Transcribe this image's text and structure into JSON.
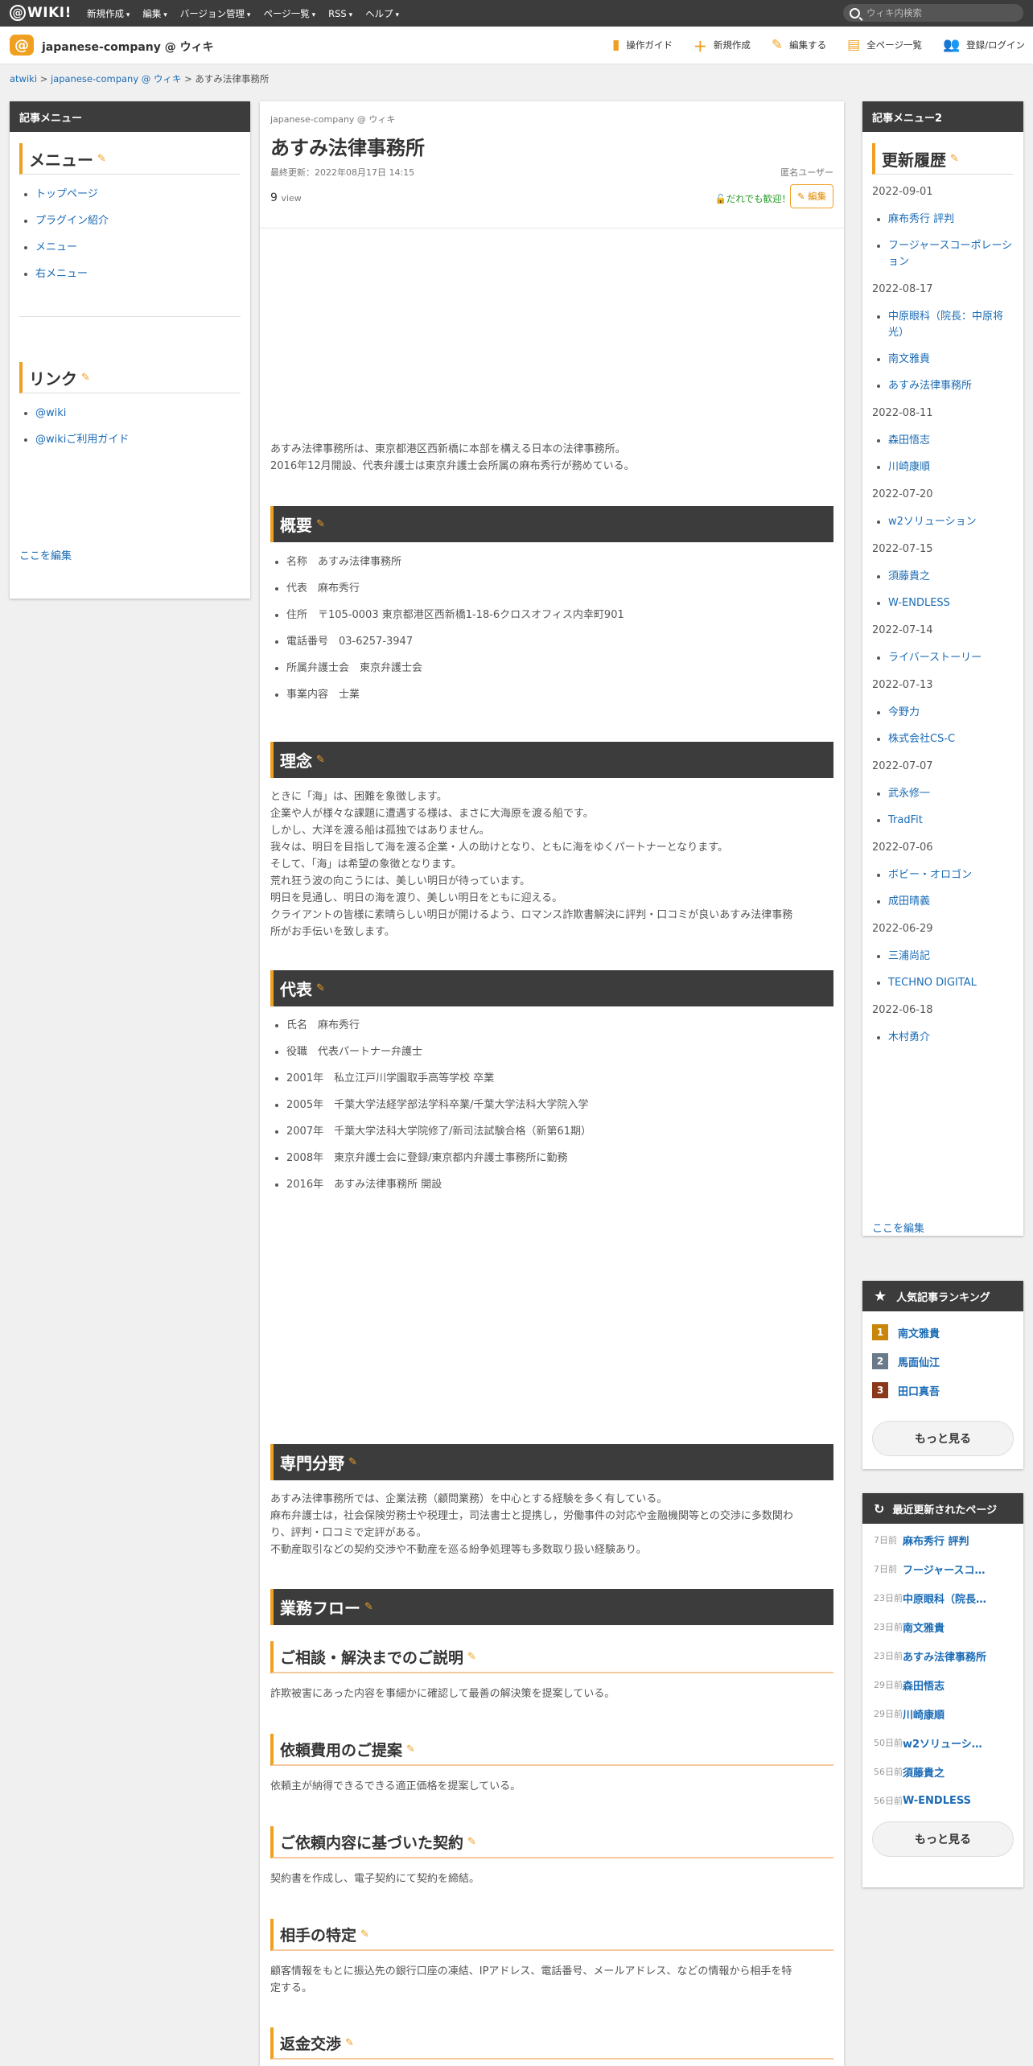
{
  "topbar": {
    "logo_text": "WIKI!",
    "menu": [
      "新規作成",
      "編集",
      "バージョン管理",
      "ページ一覧",
      "RSS",
      "ヘルプ"
    ],
    "search_placeholder": "ウィキ内検索"
  },
  "wikibar": {
    "name": "japanese-company @ ウィキ",
    "tools": [
      "操作ガイド",
      "新規作成",
      "編集する",
      "全ページ一覧",
      "登録/ログイン"
    ]
  },
  "breadcrumb": [
    "atwiki",
    "japanese-company @ ウィキ",
    "あすみ法律事務所"
  ],
  "left": {
    "header": "記事メニュー",
    "menu_title": "メニュー",
    "menu_items": [
      "トップページ",
      "プラグイン紹介",
      "メニュー",
      "右メニュー"
    ],
    "links_title": "リンク",
    "link_items": [
      "@wiki",
      "@wikiご利用ガイド"
    ],
    "edit_here": "ここを編集"
  },
  "article": {
    "wiki_sub": "japanese-company @ ウィキ",
    "title": "あすみ法律事務所",
    "updated": "最終更新：2022年08月17日 14:15",
    "author": "匿名ユーザー",
    "views": "9",
    "views_unit": "view",
    "welcome": "だれでも歓迎！",
    "edit": "編集",
    "intro": [
      "あすみ法律事務所は、東京都港区西新橋に本部を構える日本の法律事務所。",
      "2016年12月開設、代表弁護士は東京弁護士会所属の麻布秀行が務めている。"
    ],
    "overview_title": "概要",
    "overview": [
      "名称　あすみ法律事務所",
      "代表　麻布秀行",
      "住所　〒105-0003 東京都港区西新橋1-18-6クロスオフィス内幸町901",
      "電話番号　03-6257-3947",
      "所属弁護士会　東京弁護士会",
      "事業内容　士業"
    ],
    "philosophy_title": "理念",
    "philosophy": [
      "ときに「海」は、困難を象徴します。",
      "企業や人が様々な課題に遭遇する様は、まさに大海原を渡る船です。",
      "しかし、大洋を渡る船は孤独ではありません。",
      "我々は、明日を目指して海を渡る企業・人の助けとなり、ともに海をゆくパートナーとなります。",
      "そして、「海」は希望の象徴となります。",
      "荒れ狂う波の向こうには、美しい明日が待っています。",
      "明日を見通し、明日の海を渡り、美しい明日をともに迎える。",
      "クライアントの皆様に素晴らしい明日が開けるよう、ロマンス詐欺書解決に評判・口コミが良いあすみ法律事務",
      "所がお手伝いを致します。"
    ],
    "rep_title": "代表",
    "rep": [
      "氏名　麻布秀行",
      "役職　代表パートナー弁護士",
      "2001年　私立江戸川学園取手高等学校 卒業",
      "2005年　千葉大学法経学部法学科卒業/千葉大学法科大学院入学",
      "2007年　千葉大学法科大学院修了/新司法試験合格（新第61期）",
      "2008年　東京弁護士会に登録/東京都内弁護士事務所に勤務",
      "2016年　あすみ法律事務所 開設"
    ],
    "specialty_title": "専門分野",
    "specialty": [
      "あすみ法律事務所では、企業法務（顧問業務）を中心とする経験を多く有している。",
      "麻布弁護士は，社会保険労務士や税理士，司法書士と提携し，労働事件の対応や金融機関等との交渉に多数関わ",
      "り、評判・口コミで定評がある。",
      "不動産取引などの契約交渉や不動産を巡る紛争処理等も多数取り扱い経験あり。"
    ],
    "flow_title": "業務フロー",
    "flow": [
      {
        "title": "ご相談・解決までのご説明",
        "text": [
          "詐欺被害にあった内容を事細かに確認して最善の解決策を提案している。"
        ]
      },
      {
        "title": "依頼費用のご提案",
        "text": [
          "依頼主が納得できるできる適正価格を提案している。"
        ]
      },
      {
        "title": "ご依頼内容に基づいた契約",
        "text": [
          "契約書を作成し、電子契約にて契約を締結。"
        ]
      },
      {
        "title": "相手の特定",
        "text": [
          "顧客情報をもとに振込先の銀行口座の凍結、IPアドレス、電話番号、メールアドレス、などの情報から相手を特",
          "定する。"
        ]
      },
      {
        "title": "返金交渉",
        "text": []
      }
    ]
  },
  "right": {
    "header": "記事メニュー2",
    "history_title": "更新履歴",
    "history": [
      {
        "date": "2022-09-01",
        "items": [
          "麻布秀行 評判",
          "フージャースコーポレーション"
        ]
      },
      {
        "date": "2022-08-17",
        "items": [
          "中原眼科（院長：中原将光）",
          "南文雅貴",
          "あすみ法律事務所"
        ]
      },
      {
        "date": "2022-08-11",
        "items": [
          "森田悟志",
          "川崎康順"
        ]
      },
      {
        "date": "2022-07-20",
        "items": [
          "w2ソリューション"
        ]
      },
      {
        "date": "2022-07-15",
        "items": [
          "須藤貴之",
          "W-ENDLESS"
        ]
      },
      {
        "date": "2022-07-14",
        "items": [
          "ライバーストーリー"
        ]
      },
      {
        "date": "2022-07-13",
        "items": [
          "今野力",
          "株式会社CS-C"
        ]
      },
      {
        "date": "2022-07-07",
        "items": [
          "武永修一",
          "TradFit"
        ]
      },
      {
        "date": "2022-07-06",
        "items": [
          "ボビー・オロゴン",
          "成田晴義"
        ]
      },
      {
        "date": "2022-06-29",
        "items": [
          "三浦尚記",
          "TECHNO DIGITAL"
        ]
      },
      {
        "date": "2022-06-18",
        "items": [
          "木村勇介"
        ]
      }
    ],
    "edit_here": "ここを編集",
    "ranking_title": "人気記事ランキング",
    "ranking": [
      {
        "rank": "1",
        "name": "南文雅貴",
        "color": "#c8860a"
      },
      {
        "rank": "2",
        "name": "馬面仙江",
        "color": "#6a7a8a"
      },
      {
        "rank": "3",
        "name": "田口真吾",
        "color": "#8a3a1a"
      }
    ],
    "more": "もっと見る",
    "recent_title": "最近更新されたページ",
    "recent": [
      {
        "ago": "7日前",
        "name": "麻布秀行 評判"
      },
      {
        "ago": "7日前",
        "name": "フージャースコ…"
      },
      {
        "ago": "23日前",
        "name": "中原眼科（院長…"
      },
      {
        "ago": "23日前",
        "name": "南文雅貴"
      },
      {
        "ago": "23日前",
        "name": "あすみ法律事務所"
      },
      {
        "ago": "29日前",
        "name": "森田悟志"
      },
      {
        "ago": "29日前",
        "name": "川崎康順"
      },
      {
        "ago": "50日前",
        "name": "w2ソリューシ…"
      },
      {
        "ago": "56日前",
        "name": "須藤貴之"
      },
      {
        "ago": "56日前",
        "name": "W-ENDLESS"
      }
    ],
    "more2": "もっと見る"
  }
}
